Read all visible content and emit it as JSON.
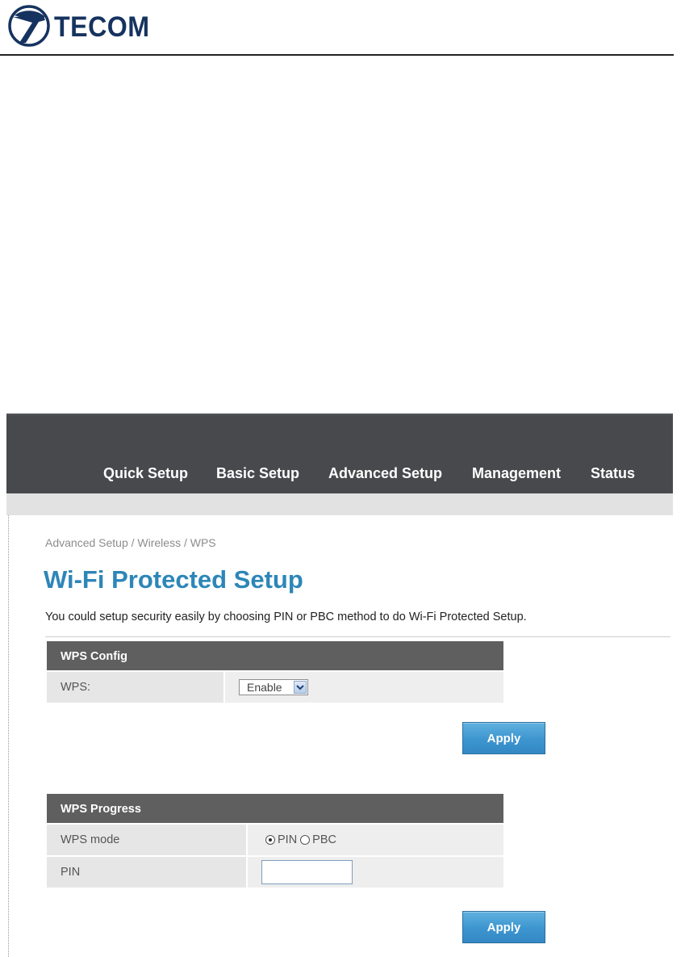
{
  "document": {
    "logo_text": "TECOM"
  },
  "nav": {
    "items": [
      "Quick Setup",
      "Basic Setup",
      "Advanced Setup",
      "Management",
      "Status"
    ]
  },
  "breadcrumb": "Advanced Setup / Wireless / WPS",
  "page_title": "Wi-Fi Protected Setup",
  "description": "You could setup security easily by choosing PIN or PBC method to do Wi-Fi Protected Setup.",
  "wps_config": {
    "heading": "WPS Config",
    "wps_label": "WPS:",
    "wps_selected": "Enable",
    "apply_label": "Apply"
  },
  "wps_progress": {
    "heading": "WPS Progress",
    "mode_label": "WPS mode",
    "mode_options": [
      "PIN",
      "PBC"
    ],
    "mode_selected": "PIN",
    "pin_label": "PIN",
    "pin_value": "",
    "apply_label": "Apply"
  },
  "colors": {
    "brand": "#16335f",
    "title_blue": "#2d86b8",
    "topbar": "#47494c",
    "button": "#3d95cf"
  }
}
